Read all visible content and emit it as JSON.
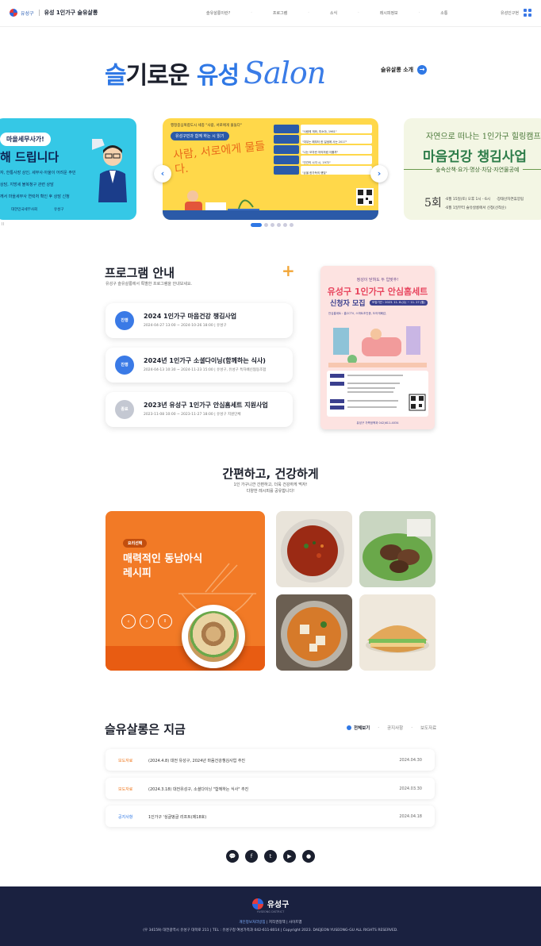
{
  "header": {
    "logo_small": "유성구",
    "site_title": "유성 1인가구 슬유살롱",
    "nav": [
      "슬유살롱이란?",
      "프로그램",
      "소식",
      "레시피정보",
      "소통"
    ],
    "right_link": "유성인구현"
  },
  "hero": {
    "title_part1": "슬",
    "title_part2": "기로운 ",
    "title_part3": "유성",
    "title_script": "Salon",
    "intro_link": "슬유살롱 소개",
    "banner_left": {
      "bubble": "마을세무사가!",
      "headline": "해 드립니다",
      "lines": [
        "자, 한통사장 상인, 세무사·아울이 어려운 주민",
        "상담, 지방세 불복청구 관련 상담",
        "께서 마을세무사 연락처 확인 후 상담 신청"
      ],
      "footer_left": "대한민국세무사회",
      "footer_right": "유성구"
    },
    "banner_center": {
      "top": "행정중심복합도시 세종 \"사람, 서로에게 물들다\"",
      "sub": "유성구민과 함께 하는 시 읽기",
      "big": "사람, 서로에게 물들다.",
      "rows": [
        "\"사람에 게와, 미소야, 1961\"",
        "\"여우는 해부터 한 일생에 사는 2017\"",
        "\"나는 모자란 저의처럼 이를까\"",
        "\"인간의 시각 시, 1972\"",
        "\"손을 한가득의 햇빛\""
      ]
    },
    "banner_right": {
      "small": "자연으로 떠나는 1인가구 힐링캠프",
      "big": "마음건강 챙김사업",
      "mid": "숲속산책·요가·명상·차담·자연물공예",
      "count": "5회",
      "info1": "·6월 15일(토) 오후 1시 - 6시",
      "info2": "·장태산자연휴양림",
      "info3": "·6월 1일부터 슬유살롱에서 신청(선착순)"
    },
    "prev": "‹",
    "next": "›"
  },
  "program": {
    "title": "프로그램 안내",
    "subtitle": "유성구 슬유살롱에서 특별한 프로그램을 안내보세요.",
    "plus": "+",
    "items": [
      {
        "badge": "진행",
        "title": "2024 1인가구 마음건강 챙김사업",
        "detail": "2024-04-27 13:00 ~ 2024-10-26 18:00  |  유성구"
      },
      {
        "badge": "진행",
        "title": "2024년 1인가구 소셜다이닝(함께하는 식사)",
        "detail": "2024-04-13 10:30 ~ 2024-11-23 15:00  |  유성구, 유성구 특자배신협동조합"
      },
      {
        "badge": "종료",
        "title": "2023년 유성구 1인가구 안심홈세트 지원사업",
        "detail": "2023-11-08 10:00 ~ 2023-11-27 18:00  |  유성구 지원단체"
      }
    ],
    "poster": {
      "top": "정성이 닫혀도 두 입맞추!",
      "title1": "유성구 1인가구 안심홈세트",
      "title2": "신청자 모집",
      "period": "모집기간 : 2023. 11. 8.(수) ~ 11. 27.(월)",
      "items": "안심홈세트 : 홈CCTV, 스마트초인종, 도어게폐감,",
      "footer": "유성구 가족정책과  042)611-4034"
    }
  },
  "health": {
    "title": "간편하고, 건강하게",
    "subtitle1": "1인 가구니깐 간편하고, 더욱 건강하게 먹자!",
    "subtitle2": "다양한 레시피를 공유합니다!",
    "recipe_tag": "요리선택",
    "recipe_title1": "매력적인 동남아식",
    "recipe_title2": "레시피",
    "ctl_prev": "‹",
    "ctl_next": "›",
    "ctl_pause": "II"
  },
  "news": {
    "title": "슬유살롱은 지금",
    "tabs": [
      "전체보기",
      "공지사항",
      "보도자료"
    ],
    "rows": [
      {
        "cat": "보도자료",
        "text": "(2024.4.8) 대전 유성구, 2024년 마음건강챙김사업 추진",
        "date": "2024.04.30"
      },
      {
        "cat": "보도자료",
        "text": "(2024.3.18) 대전유성구, 소셜다이닝 \"함께하는 식사\" 추진",
        "date": "2024.03.30"
      },
      {
        "cat": "공지사항",
        "text": "1인가구 '싱글벙글 리프트(제18호)",
        "date": "2024.04.18"
      }
    ]
  },
  "sns": [
    "💬",
    "f",
    "t",
    "▶",
    "●"
  ],
  "footer": {
    "logo": "유성구",
    "logo_sub": "YUSEONG DISTRICT",
    "link1": "개인정보처리방침",
    "link2": "저작권정책",
    "link3": "사이트맵",
    "address": "(우 34159) 대전광역시 유성구 대학로 211  |  TEL : 유성구청 여성가족과 042-611-8014  |  Copyright 2023. DAEJEON YUSEONG-GU ALL RIGHTS RESERVED."
  },
  "colors": {
    "accent": "#2f78e5",
    "orange": "#f27a26",
    "footer": "#1a2140"
  }
}
